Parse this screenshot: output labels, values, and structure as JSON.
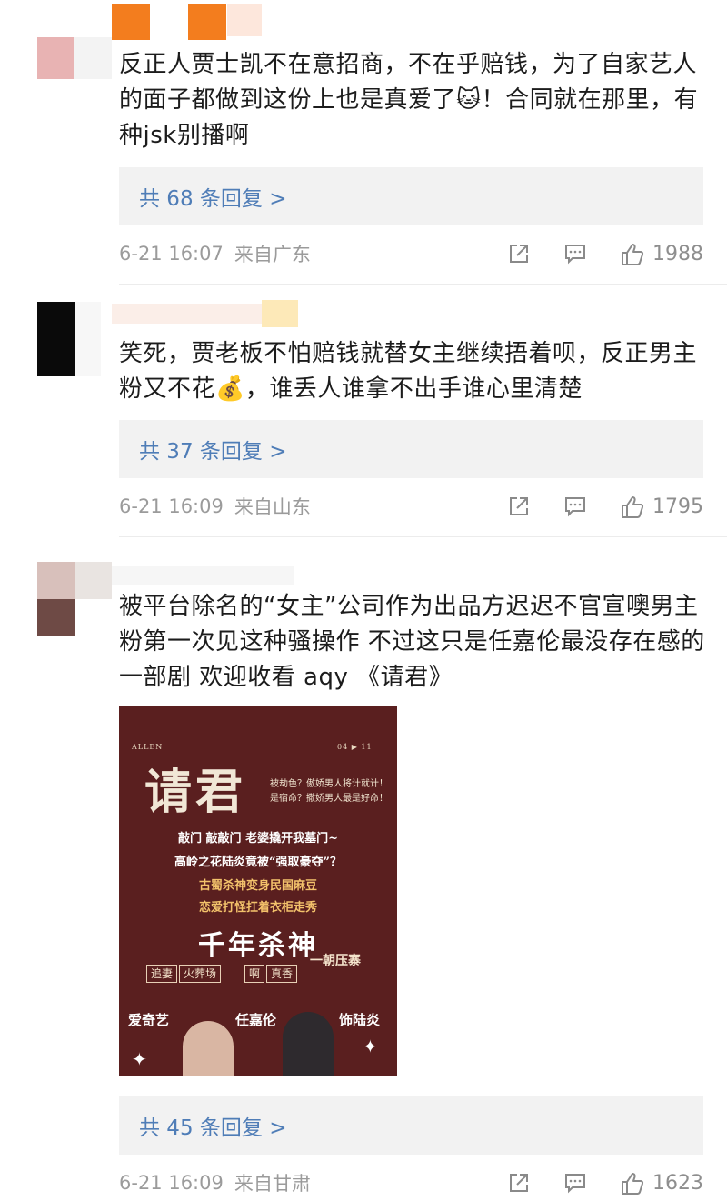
{
  "comments": [
    {
      "text": "反正人贾士凯不在意招商，不在乎赔钱，为了自家艺人的面子都做到这份上也是真爱了🐱！合同就在那里，有种jsk别播啊",
      "replies": "共 68 条回复 >",
      "time": "6-21 16:07",
      "location": "来自广东",
      "likes": "1988"
    },
    {
      "text": "笑死，贾老板不怕赔钱就替女主继续捂着呗，反正男主粉又不花💰，谁丢人谁拿不出手谁心里清楚",
      "replies": "共 37 条回复 >",
      "time": "6-21 16:09",
      "location": "来自山东",
      "likes": "1795"
    },
    {
      "text": "被平台除名的“女主”公司作为出品方迟迟不官宣噢男主粉第一次见这种骚操作 不过这只是任嘉伦最没存在感的一部剧 欢迎收看 aqy 《请君》",
      "replies": "共 45 条回复 >",
      "time": "6-21 16:09",
      "location": "来自甘肃",
      "likes": "1623"
    }
  ],
  "poster": {
    "brand": "ALLEN",
    "page": "04  ▶  11",
    "logo": "请君",
    "tag1": "被劫色？傲娇男人将计就计！",
    "tag2": "是宿命？撒娇男人最是好命！",
    "line1": "敲门  敲敲门  老婆撬开我墓门~",
    "line2": "高岭之花陆炎竟被“强取豪夺”？",
    "line3": "古蜀杀神变身民国麻豆",
    "line4": "恋爱打怪扛着衣柜走秀",
    "big": "千年杀神",
    "chips": [
      "追妻",
      "火葬场",
      "啊",
      "真香"
    ],
    "stamp": "一朝压寨",
    "credit_left": "爱奇艺",
    "credit_mid": "任嘉伦",
    "credit_right": "饰陆炎"
  },
  "colors": {
    "reply_link": "#4f7db7",
    "reply_bg": "#f2f2f2",
    "meta": "#9b9b9b",
    "poster_bg": "#5a1f1f"
  },
  "icons": [
    "share-icon",
    "comment-icon",
    "like-icon"
  ]
}
